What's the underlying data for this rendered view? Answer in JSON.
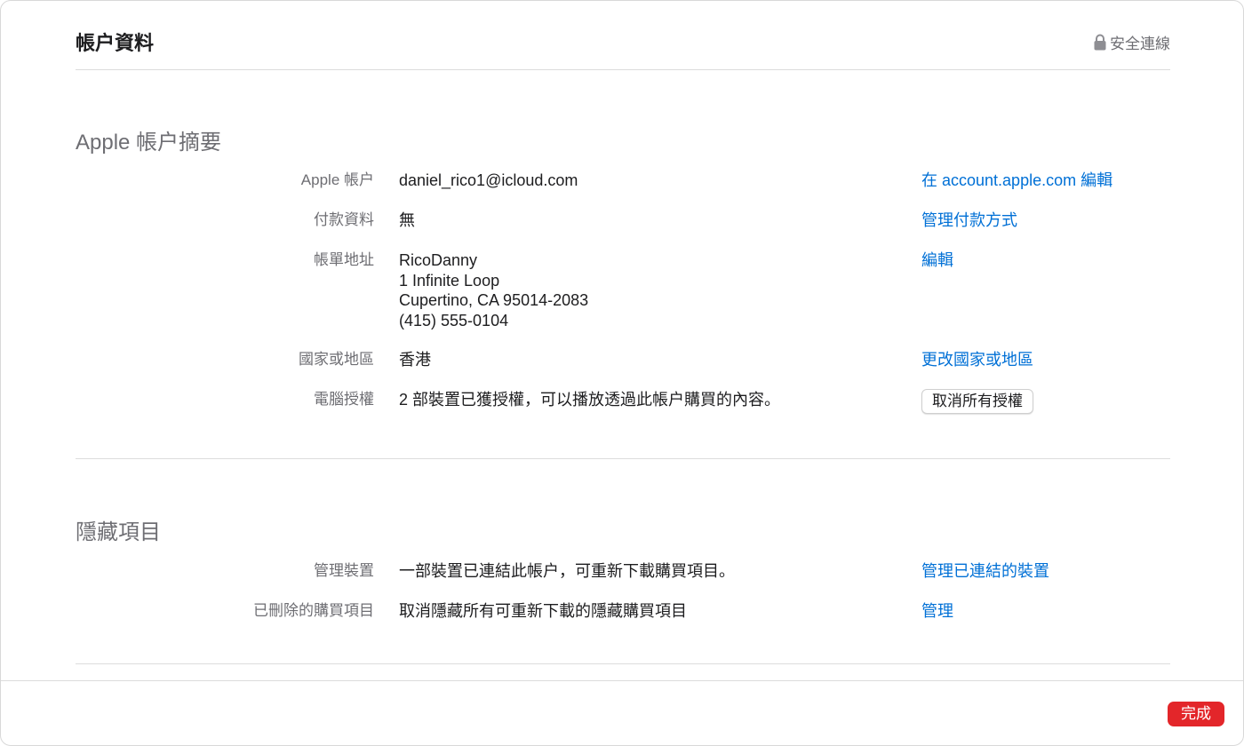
{
  "header": {
    "title": "帳户資料",
    "secure_label": "安全連線"
  },
  "summary": {
    "section_title": "Apple 帳户摘要",
    "rows": [
      {
        "label": "Apple 帳户",
        "value": "daniel_rico1@icloud.com",
        "action": "在 account.apple.com 編輯"
      },
      {
        "label": "付款資料",
        "value": "無",
        "action": "管理付款方式"
      },
      {
        "label": "帳單地址",
        "value_lines": [
          "RicoDanny",
          "1 Infinite Loop",
          "Cupertino, CA 95014-2083",
          "(415) 555-0104"
        ],
        "action": "編輯"
      },
      {
        "label": "國家或地區",
        "value": "香港",
        "action": "更改國家或地區"
      },
      {
        "label": "電腦授權",
        "value": "2 部裝置已獲授權，可以播放透過此帳户購買的內容。",
        "action_button": "取消所有授權"
      }
    ]
  },
  "hidden": {
    "section_title": "隱藏項目",
    "rows": [
      {
        "label": "管理裝置",
        "value": "一部裝置已連結此帳户，可重新下載購買項目。",
        "action": "管理已連結的裝置"
      },
      {
        "label": "已刪除的購買項目",
        "value": "取消隱藏所有可重新下載的隱藏購買項目",
        "action": "管理"
      }
    ]
  },
  "footer": {
    "done_label": "完成"
  },
  "colors": {
    "link": "#0070d6",
    "done_button": "#e3262a",
    "label": "#6e6e73"
  },
  "icons": {
    "secure": "lock-icon"
  }
}
